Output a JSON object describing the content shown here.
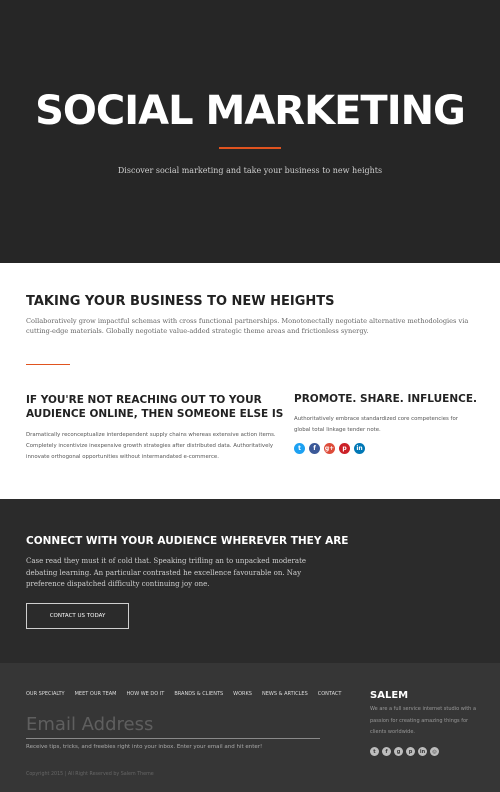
{
  "hero": {
    "title": "SOCIAL MARKETING",
    "subtitle": "Discover social marketing and take your business to new heights"
  },
  "intro": {
    "title": "TAKING YOUR BUSINESS TO NEW HEIGHTS",
    "text": "Collaboratively grow impactful schemas with cross functional partnerships. Monotonectally negotiate alternative methodologies via cutting-edge materials. Globally negotiate value-added strategic theme areas and frictionless synergy."
  },
  "left": {
    "heading": "IF YOU'RE NOT REACHING OUT TO YOUR AUDIENCE ONLINE, THEN SOMEONE ELSE IS",
    "text": "Dramatically reconceptualize interdependent supply chains whereas extensive action items. Completely incentivize inexpensive growth strategies after distributed data. Authoritatively innovate orthogonal opportunities without intermandated e-commerce."
  },
  "right": {
    "heading": "PROMOTE. SHARE. INFLUENCE.",
    "text": "Authoritatively embrace standardized core competencies for global total linkage tender note.",
    "social": [
      {
        "icon": "twitter-icon",
        "glyph": "t",
        "color": "#1da1f2"
      },
      {
        "icon": "facebook-icon",
        "glyph": "f",
        "color": "#3b5998"
      },
      {
        "icon": "google-plus-icon",
        "glyph": "g+",
        "color": "#dd4b39"
      },
      {
        "icon": "pinterest-icon",
        "glyph": "p",
        "color": "#cb2027"
      },
      {
        "icon": "linkedin-icon",
        "glyph": "in",
        "color": "#0077b5"
      }
    ]
  },
  "connect": {
    "title": "CONNECT WITH YOUR AUDIENCE WHEREVER THEY ARE",
    "text": "Case read they must it of cold that. Speaking trifling an to unpacked moderate debating learning. An particular contrasted he excellence favourable on. Nay preference dispatched difficulty continuing joy one.",
    "button": "CONTACT US TODAY"
  },
  "footer": {
    "nav": [
      "OUR SPECIALTY",
      "MEET OUR TEAM",
      "HOW WE DO IT",
      "BRANDS & CLIENTS",
      "WORKS",
      "NEWS & ARTICLES",
      "CONTACT"
    ],
    "email_placeholder": "Email Address",
    "note": "Receive tips, tricks, and freebies right into your inbox. Enter your email and hit enter!",
    "copyright": "Copyright 2015 | All Right Reserved by Salem Theme",
    "brand": "SALEM",
    "brand_text": "We are a full service internet studio with a passion for creating amazing things for clients worldwide.",
    "social": [
      {
        "icon": "twitter-icon",
        "glyph": "t"
      },
      {
        "icon": "facebook-icon",
        "glyph": "f"
      },
      {
        "icon": "google-plus-icon",
        "glyph": "g"
      },
      {
        "icon": "pinterest-icon",
        "glyph": "p"
      },
      {
        "icon": "linkedin-icon",
        "glyph": "in"
      },
      {
        "icon": "dribbble-icon",
        "glyph": "◎"
      }
    ]
  }
}
